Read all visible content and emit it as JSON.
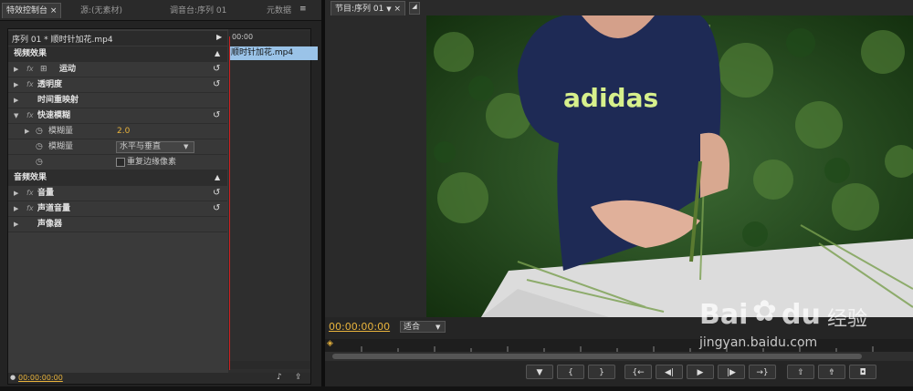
{
  "left_tabs": [
    {
      "label": "特效控制台",
      "close": "×"
    },
    {
      "label": "源:(无素材)"
    },
    {
      "label": "调音台:序列 01"
    },
    {
      "label": "元数据"
    }
  ],
  "left_menu_icon": "≡",
  "effect_controls": {
    "header": "序列 01 * 顺时针加花.mp4",
    "clip_name": "顺时针加花.mp4",
    "timecode_start": "00:00",
    "footer_timecode": "00:00:00:00",
    "rows": [
      {
        "type": "section",
        "label": "视频效果"
      },
      {
        "type": "effect",
        "label": "运动",
        "fx": "fx"
      },
      {
        "type": "effect",
        "label": "透明度",
        "fx": "fx"
      },
      {
        "type": "effect",
        "label": "时间重映射",
        "fx": ""
      },
      {
        "type": "effect",
        "label": "快速模糊",
        "fx": "fx"
      },
      {
        "type": "param",
        "label": "模糊量",
        "value": "2.0"
      },
      {
        "type": "param",
        "label": "模糊量",
        "value": "水平与垂直"
      },
      {
        "type": "checkbox",
        "label": "重复边缘像素"
      },
      {
        "type": "section",
        "label": "音频效果"
      },
      {
        "type": "effect",
        "label": "音量",
        "fx": "fx"
      },
      {
        "type": "effect",
        "label": "声道音量",
        "fx": "fx"
      },
      {
        "type": "effect",
        "label": "声像器",
        "fx": ""
      }
    ]
  },
  "program_monitor": {
    "tab_label": "节目:序列 01",
    "timecode": "00:00:00:00",
    "zoom_value": "适合",
    "shirt_text": "adidas"
  },
  "watermark": {
    "brand": "Bai",
    "paw": "du",
    "cn": "经验",
    "url": "jingyan.baidu.com"
  },
  "transport_buttons": [
    {
      "name": "marker-button",
      "glyph": "▼"
    },
    {
      "name": "set-in-button",
      "glyph": "{"
    },
    {
      "name": "set-out-button",
      "glyph": "}"
    },
    {
      "name": "goto-in-button",
      "glyph": "{←"
    },
    {
      "name": "step-back-button",
      "glyph": "◀|"
    },
    {
      "name": "play-button",
      "glyph": "▶"
    },
    {
      "name": "step-forward-button",
      "glyph": "|▶"
    },
    {
      "name": "goto-out-button",
      "glyph": "→}"
    },
    {
      "name": "lift-button",
      "glyph": "⇧"
    },
    {
      "name": "extract-button",
      "glyph": "⇮"
    },
    {
      "name": "export-frame-button",
      "glyph": "◘"
    }
  ],
  "colors": {
    "accent_timecode": "#e8b33c",
    "clip": "#9ac3e8",
    "playhead": "#d02020"
  }
}
